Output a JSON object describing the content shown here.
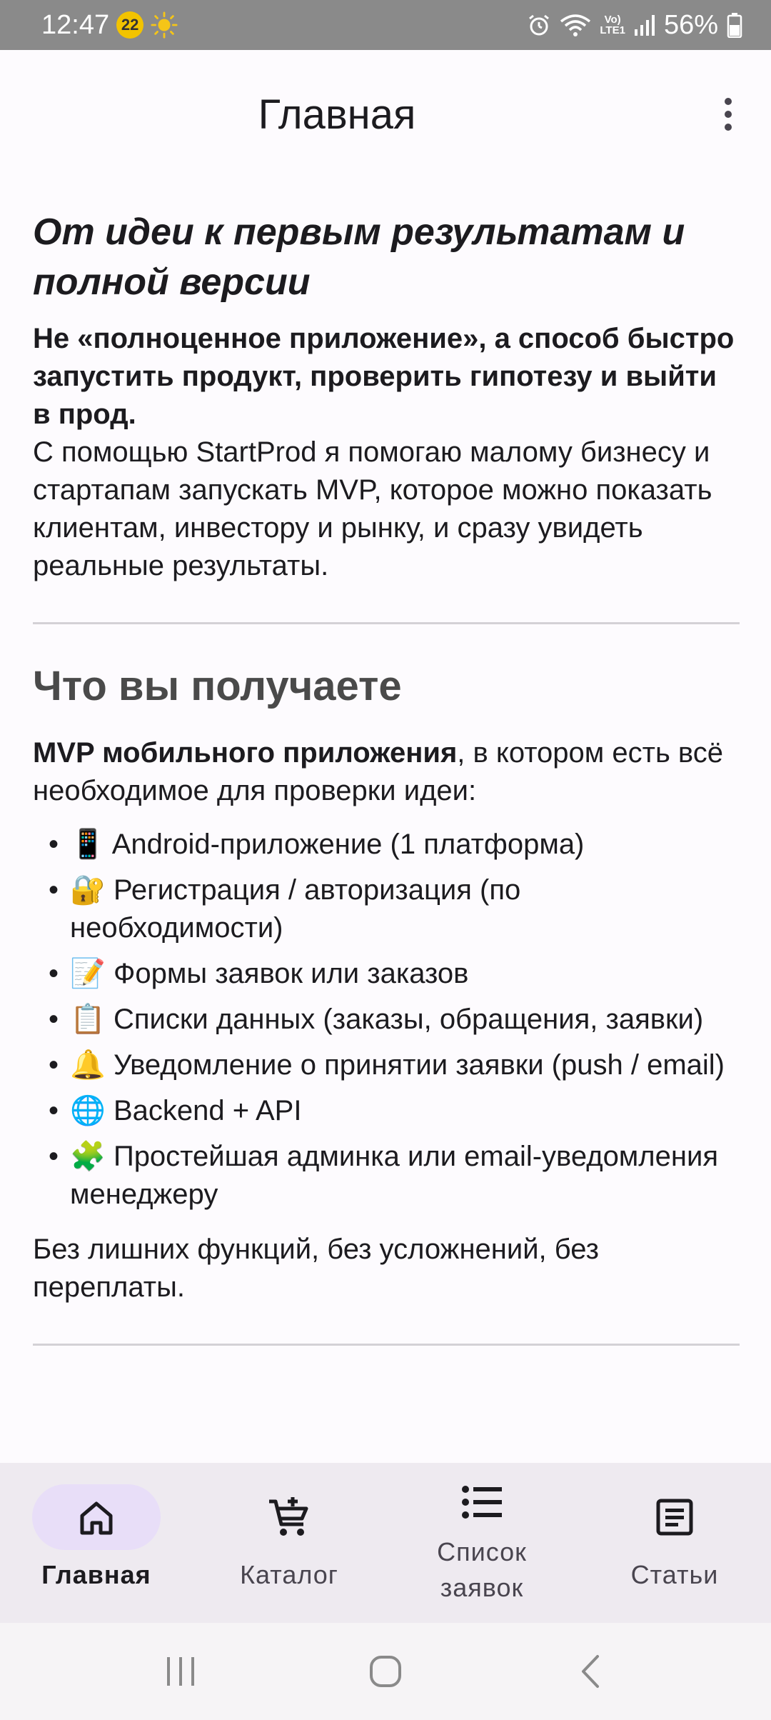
{
  "status_bar": {
    "time": "12:47",
    "notification_count": "22",
    "battery": "56%",
    "icons": [
      "sun-icon",
      "alarm-icon",
      "wifi-icon",
      "volte-lte-icon",
      "signal-icon",
      "battery-icon"
    ],
    "volte_line1": "Vo)",
    "volte_line2": "LTE1"
  },
  "app_bar": {
    "title": "Главная",
    "menu_icon": "more-vert-icon"
  },
  "hero": {
    "title": "От идеи к первым результатам и полной версии",
    "lead": "Не «полноценное приложение», а способ быстро запустить продукт, проверить гипотезу и выйти в прод.",
    "body": "С помощью StartProd я помогаю малому бизнесу и стартапам запускать MVP, которое можно показать клиентам, инвестору и рынку, и сразу увидеть реальные результаты."
  },
  "section": {
    "title": "Что вы получаете",
    "intro_bold": "MVP мобильного приложения",
    "intro_rest": ", в котором есть всё необходимое для проверки идеи:",
    "features": [
      {
        "emoji": "📱",
        "text": "Android-приложение (1 платформа)"
      },
      {
        "emoji": "🔐",
        "text": "Регистрация / авторизация (по необходимости)"
      },
      {
        "emoji": "📝",
        "text": "Формы заявок или заказов"
      },
      {
        "emoji": "📋",
        "text": "Списки данных (заказы, обращения, заявки)"
      },
      {
        "emoji": "🔔",
        "text": "Уведомление о принятии заявки (push / email)"
      },
      {
        "emoji": "🌐",
        "text": "Backend + API"
      },
      {
        "emoji": "🧩",
        "text": "Простейшая админка или email-уведомления менеджеру"
      }
    ],
    "bullet": "•",
    "closing": "Без лишних функций, без усложнений, без переплаты."
  },
  "bottom_nav": {
    "items": [
      {
        "label": "Главная",
        "icon": "home-icon",
        "active": true
      },
      {
        "label": "Каталог",
        "icon": "cart-add-icon",
        "active": false
      },
      {
        "label": "Список заявок",
        "icon": "list-icon",
        "active": false
      },
      {
        "label": "Статьи",
        "icon": "article-icon",
        "active": false
      }
    ]
  },
  "colors": {
    "status_bar": "#8a8a8a",
    "background": "#fdfbfe",
    "nav_background": "#eeeaf0",
    "active_indicator": "#e8def8",
    "section_title": "#4a4a4a"
  }
}
